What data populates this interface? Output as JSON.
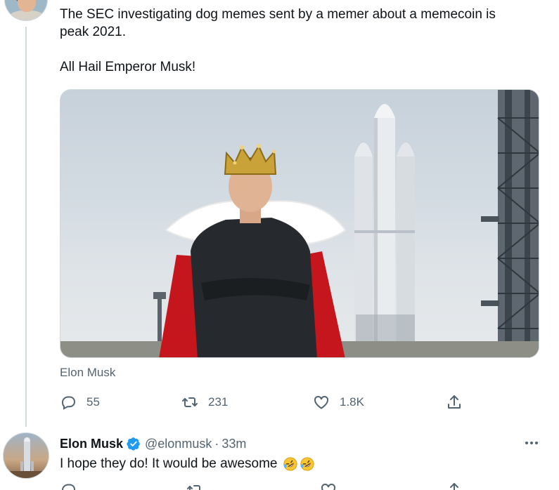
{
  "parent_tweet": {
    "text_line1": "The SEC investigating dog memes sent by a memer about a memecoin is",
    "text_line2": "peak 2021.",
    "text_line3": "All Hail Emperor Musk!",
    "media_caption": "Elon Musk",
    "actions": {
      "replies": "55",
      "retweets": "231",
      "likes": "1.8K"
    }
  },
  "reply_tweet": {
    "name": "Elon Musk",
    "handle": "@elonmusk",
    "separator": "·",
    "time": "33m",
    "text": "I hope they do! It would be awesome",
    "emoji": [
      "rolling-on-floor-laughing-emoji",
      "rolling-on-floor-laughing-emoji"
    ],
    "verified": true
  },
  "icons": {
    "reply": "reply-icon",
    "retweet": "retweet-icon",
    "like": "heart-icon",
    "share": "share-icon",
    "more": "more-icon",
    "verified": "verified-badge-icon"
  },
  "colors": {
    "text_primary": "#0f1419",
    "text_secondary": "#536471",
    "verified_blue": "#1d9bf0",
    "divider": "#cfd9de"
  }
}
